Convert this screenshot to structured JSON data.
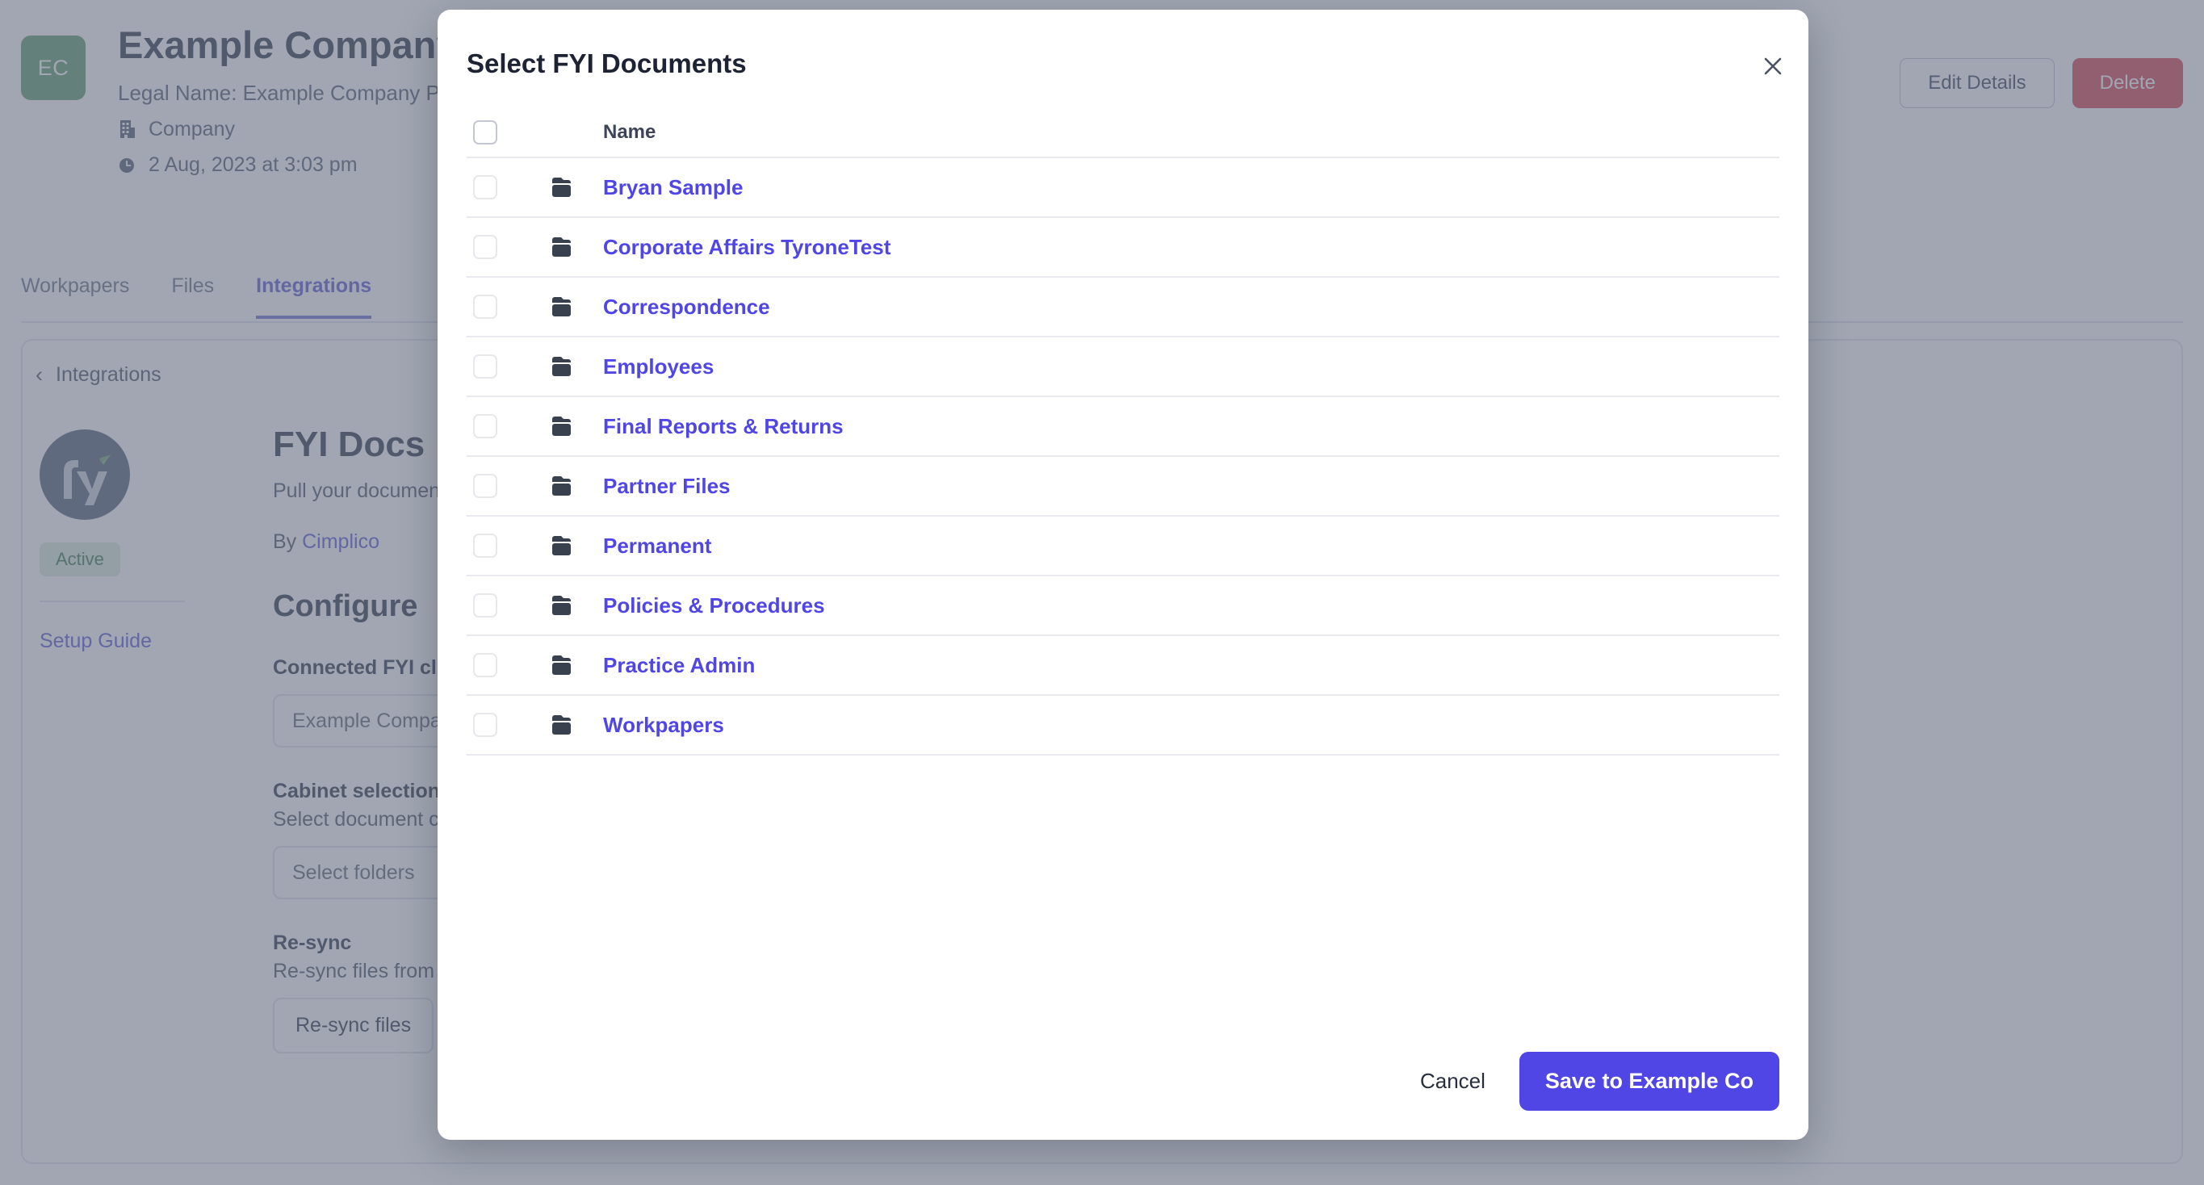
{
  "background": {
    "entity": {
      "avatar_initials": "EC",
      "title": "Example Company",
      "legal_name": "Legal Name: Example Company Pty Ltd",
      "type_label": "Company",
      "type_icon": "building-icon",
      "timestamp": "2 Aug, 2023 at 3:03 pm",
      "timestamp_icon": "clock-icon"
    },
    "actions": {
      "edit_label": "Edit Details",
      "delete_label": "Delete"
    },
    "tabs": [
      {
        "label": "Workpapers",
        "active": false
      },
      {
        "label": "Files",
        "active": false
      },
      {
        "label": "Integrations",
        "active": true
      }
    ],
    "integration": {
      "breadcrumb_label": "Integrations",
      "back_icon": "chevron-left-icon",
      "logo_icon": "fyi-logo-icon",
      "status_badge": "Active",
      "setup_guide_label": "Setup Guide",
      "title": "FYI Docs",
      "description": "Pull your documents from FYI into this workspace.",
      "by_prefix": "By ",
      "by_vendor": "Cimplico",
      "config_heading": "Configure",
      "fields": [
        {
          "label": "Connected FYI client",
          "value": "Example Company Pty Ltd"
        },
        {
          "label": "Cabinet selection",
          "help": "Select document cabinets to sync",
          "value": "Select folders"
        },
        {
          "label": "Re-sync",
          "help": "Re-sync files from the connected FYI client",
          "button_label": "Re-sync files"
        }
      ]
    }
  },
  "modal": {
    "title": "Select FYI Documents",
    "close_icon": "close-icon",
    "table": {
      "select_all_checked": false,
      "columns": [
        "Name"
      ],
      "rows": [
        {
          "name": "Bryan Sample",
          "icon": "folder-icon",
          "checked": false
        },
        {
          "name": "Corporate Affairs TyroneTest",
          "icon": "folder-icon",
          "checked": false
        },
        {
          "name": "Correspondence",
          "icon": "folder-icon",
          "checked": false
        },
        {
          "name": "Employees",
          "icon": "folder-icon",
          "checked": false
        },
        {
          "name": "Final Reports & Returns",
          "icon": "folder-icon",
          "checked": false
        },
        {
          "name": "Partner Files",
          "icon": "folder-icon",
          "checked": false
        },
        {
          "name": "Permanent",
          "icon": "folder-icon",
          "checked": false
        },
        {
          "name": "Policies & Procedures",
          "icon": "folder-icon",
          "checked": false
        },
        {
          "name": "Practice Admin",
          "icon": "folder-icon",
          "checked": false
        },
        {
          "name": "Workpapers",
          "icon": "folder-icon",
          "checked": false
        }
      ]
    },
    "footer": {
      "cancel_label": "Cancel",
      "save_label": "Save to Example Co"
    }
  },
  "colors": {
    "accent": "#4f46e5",
    "link": "#5b5bd6",
    "avatar": "#5f9c6e",
    "danger": "#d64550",
    "folder": "#39414f",
    "overlay": "rgba(103,111,130,0.62)"
  }
}
